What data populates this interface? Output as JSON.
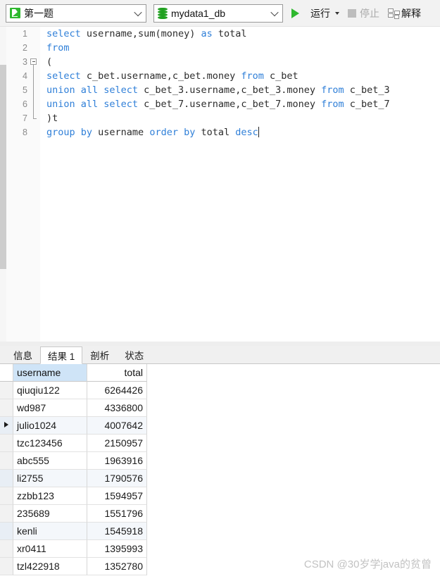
{
  "toolbar": {
    "query_selector": {
      "icon": "query-document-icon",
      "value": "第一题"
    },
    "database_selector": {
      "icon": "database-icon",
      "value": "mydata1_db"
    },
    "run_button": {
      "icon": "play-icon",
      "label": "运行"
    },
    "stop_button": {
      "icon": "stop-square-icon",
      "label": "停止"
    },
    "explain_button": {
      "icon": "explain-plan-icon",
      "label": "解释"
    }
  },
  "editor": {
    "lines": [
      {
        "number": "1",
        "fold": "none",
        "tokens": [
          {
            "t": "kw",
            "s": "select"
          },
          {
            "t": "p",
            "s": " username,sum(money) "
          },
          {
            "t": "kw",
            "s": "as"
          },
          {
            "t": "p",
            "s": " total"
          }
        ]
      },
      {
        "number": "2",
        "fold": "none",
        "tokens": [
          {
            "t": "kw",
            "s": "from"
          }
        ]
      },
      {
        "number": "3",
        "fold": "start",
        "tokens": [
          {
            "t": "p",
            "s": "("
          }
        ]
      },
      {
        "number": "4",
        "fold": "mid",
        "tokens": [
          {
            "t": "kw",
            "s": "select"
          },
          {
            "t": "p",
            "s": " c_bet.username,c_bet.money "
          },
          {
            "t": "kw",
            "s": "from"
          },
          {
            "t": "p",
            "s": " c_bet"
          }
        ]
      },
      {
        "number": "5",
        "fold": "mid",
        "tokens": [
          {
            "t": "kw",
            "s": "union all select"
          },
          {
            "t": "p",
            "s": " c_bet_3.username,c_bet_3.money "
          },
          {
            "t": "kw",
            "s": "from"
          },
          {
            "t": "p",
            "s": " c_bet_3"
          }
        ]
      },
      {
        "number": "6",
        "fold": "mid",
        "tokens": [
          {
            "t": "kw",
            "s": "union all select"
          },
          {
            "t": "p",
            "s": " c_bet_7.username,c_bet_7.money "
          },
          {
            "t": "kw",
            "s": "from"
          },
          {
            "t": "p",
            "s": " c_bet_7"
          }
        ]
      },
      {
        "number": "7",
        "fold": "end",
        "tokens": [
          {
            "t": "p",
            "s": ")t"
          }
        ]
      },
      {
        "number": "8",
        "fold": "none",
        "caret": true,
        "tokens": [
          {
            "t": "kw",
            "s": "group by"
          },
          {
            "t": "p",
            "s": " username "
          },
          {
            "t": "kw",
            "s": "order by"
          },
          {
            "t": "p",
            "s": " total "
          },
          {
            "t": "kw",
            "s": "desc"
          }
        ]
      }
    ]
  },
  "result_panel": {
    "tabs": [
      {
        "label": "信息",
        "active": false
      },
      {
        "label": "结果 1",
        "active": true
      },
      {
        "label": "剖析",
        "active": false
      },
      {
        "label": "状态",
        "active": false
      }
    ],
    "grid": {
      "columns": [
        "username",
        "total"
      ],
      "selected_column": "username",
      "current_row_index": 3,
      "rows": [
        {
          "username": "qiuqiu122",
          "total": "6264426"
        },
        {
          "username": "wd987",
          "total": "4336800"
        },
        {
          "username": "julio1024",
          "total": "4007642"
        },
        {
          "username": "tzc123456",
          "total": "2150957"
        },
        {
          "username": "abc555",
          "total": "1963916"
        },
        {
          "username": "li2755",
          "total": "1790576"
        },
        {
          "username": "zzbb123",
          "total": "1594957"
        },
        {
          "username": "235689",
          "total": "1551796"
        },
        {
          "username": "kenli",
          "total": "1545918"
        },
        {
          "username": "xr0411",
          "total": "1395993"
        },
        {
          "username": "tzl422918",
          "total": "1352780"
        }
      ]
    }
  },
  "watermark": "CSDN @30岁学java的贫曾",
  "colors": {
    "accent_green": "#2eb82e",
    "keyword_blue": "#2f7fd8",
    "selected_header": "#cfe4f7"
  }
}
